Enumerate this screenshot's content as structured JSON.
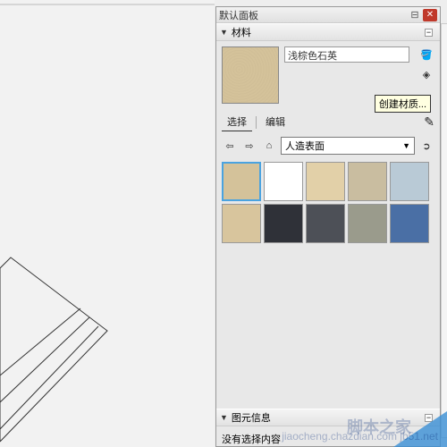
{
  "panel": {
    "title": "默认面板",
    "sections": {
      "materials": "材料",
      "entity_info": "图元信息"
    }
  },
  "material": {
    "name": "浅棕色石英",
    "tooltip_create": "创建材质...",
    "tabs": {
      "select": "选择",
      "edit": "编辑"
    },
    "category": "人造表面"
  },
  "swatches": [
    {
      "color": "#d4c29a",
      "selected": true
    },
    {
      "color": "#ffffff"
    },
    {
      "color": "#e2d0a8"
    },
    {
      "color": "#c9bda0"
    },
    {
      "color": "#b9cad6"
    },
    {
      "color": "#d8c59d"
    },
    {
      "color": "#2f3138"
    },
    {
      "color": "#4d5057"
    },
    {
      "color": "#9a9b8c"
    },
    {
      "color": "#4a6fa5"
    }
  ],
  "entity_info": {
    "status": "没有选择内容"
  },
  "watermark": {
    "main": "脚本之家",
    "sub": "jiaocheng.chazdian.com jb51.net"
  }
}
